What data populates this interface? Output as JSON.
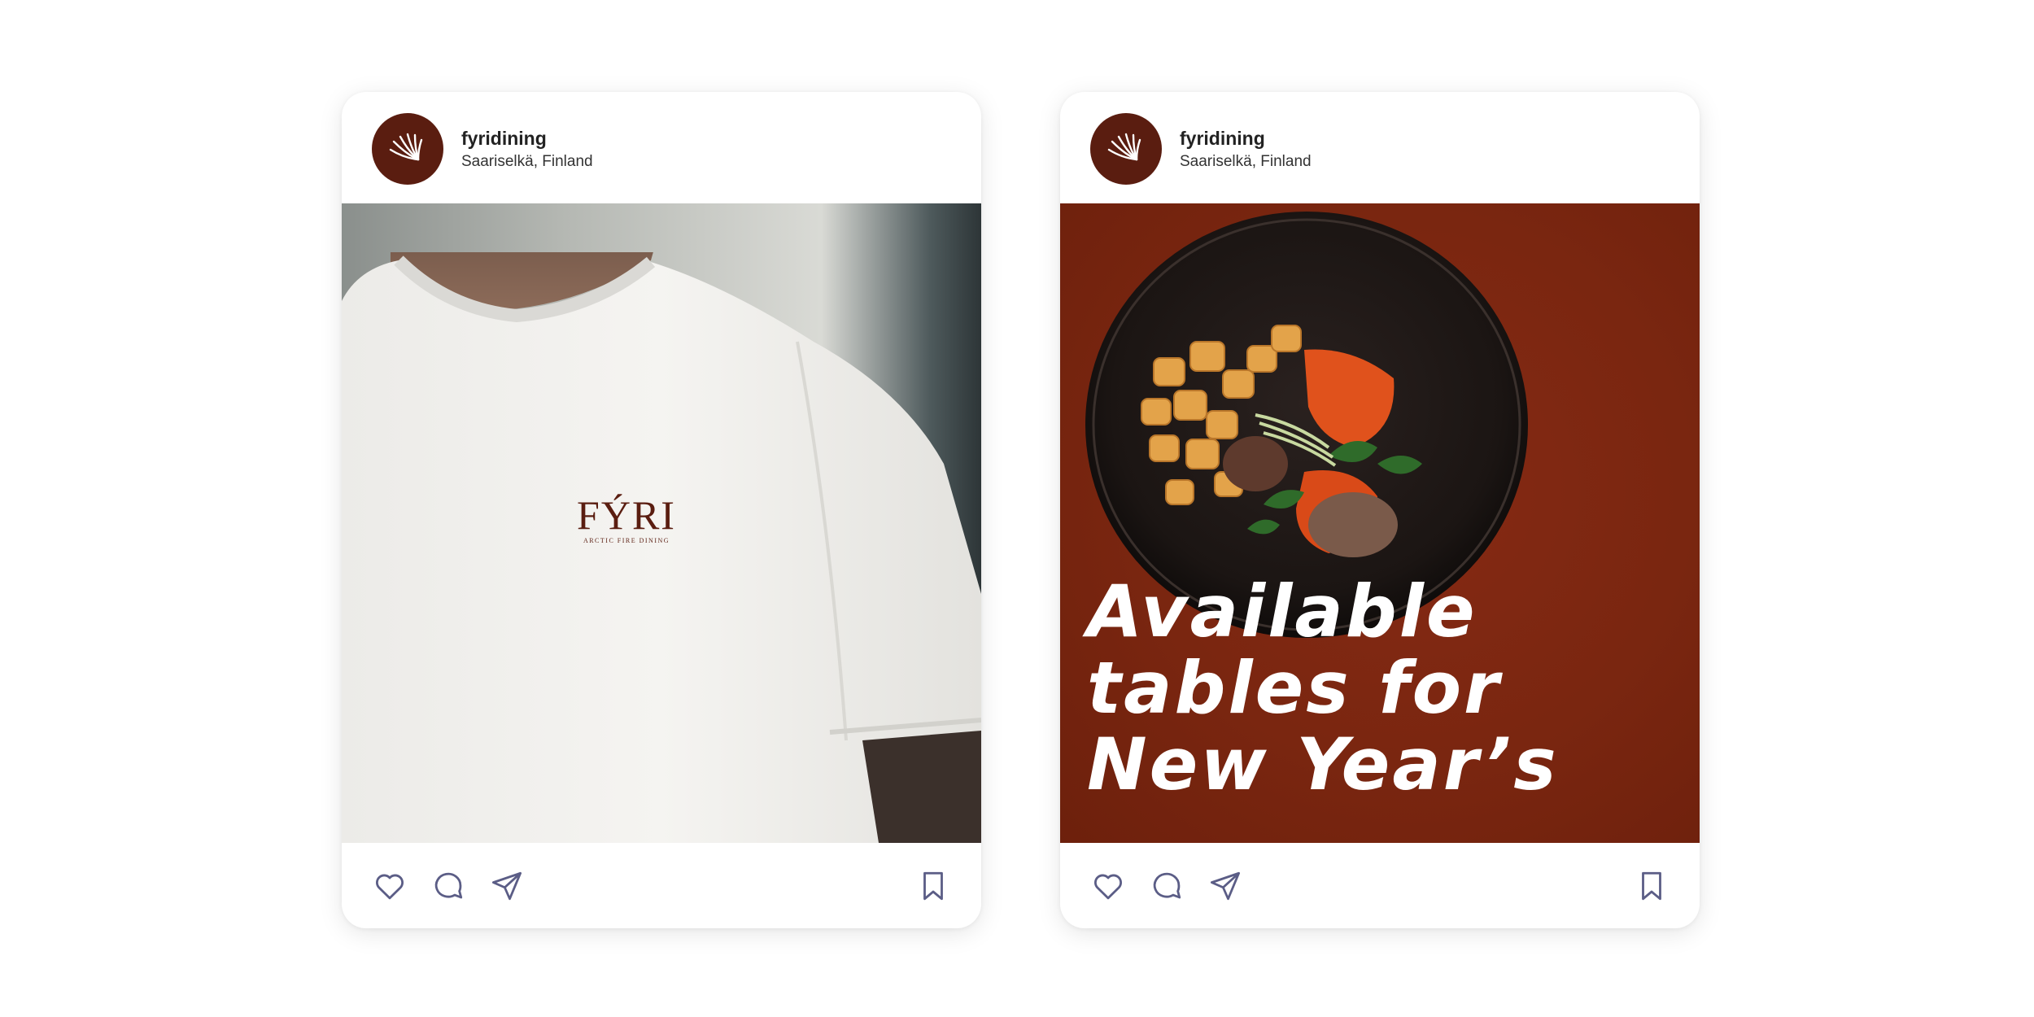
{
  "posts": [
    {
      "username": "fyridining",
      "location": "Saariselkä, Finland",
      "media": {
        "brand_name": "FÝRI",
        "brand_tagline": "ARCTIC FIRE DINING"
      }
    },
    {
      "username": "fyridining",
      "location": "Saariselkä, Finland",
      "media": {
        "promo_line_1": "Available",
        "promo_line_2": "tables for",
        "promo_line_3": "New Year’s"
      }
    }
  ],
  "icons": {
    "like": "heart-icon",
    "comment": "comment-icon",
    "share": "send-icon",
    "save": "bookmark-icon"
  },
  "colors": {
    "brand_dark": "#5a1d10",
    "promo_background": "#7a2610",
    "icon_stroke": "#5b5d86"
  }
}
